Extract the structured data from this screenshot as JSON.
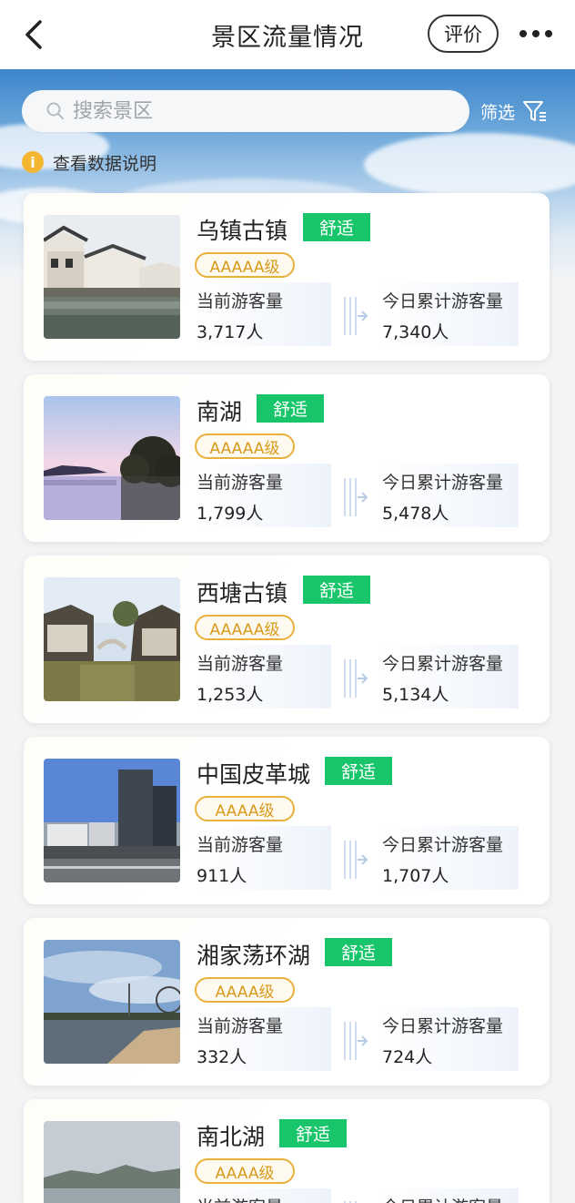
{
  "header": {
    "title": "景区流量情况",
    "rate_label": "评价"
  },
  "search": {
    "placeholder": "搜索景区",
    "filter_label": "筛选"
  },
  "data_note": "查看数据说明",
  "stat_labels": {
    "current": "当前游客量",
    "today": "今日累计游客量"
  },
  "colors": {
    "comfort_green": "#19c56a",
    "level_gold": "#e8b13c",
    "info_yellow": "#f3b633"
  },
  "spots": [
    {
      "name": "乌镇古镇",
      "status": "舒适",
      "level": "AAAAA级",
      "current": "3,717人",
      "today": "7,340人"
    },
    {
      "name": "南湖",
      "status": "舒适",
      "level": "AAAAA级",
      "current": "1,799人",
      "today": "5,478人"
    },
    {
      "name": "西塘古镇",
      "status": "舒适",
      "level": "AAAAA级",
      "current": "1,253人",
      "today": "5,134人"
    },
    {
      "name": "中国皮革城",
      "status": "舒适",
      "level": "AAAA级",
      "current": "911人",
      "today": "1,707人"
    },
    {
      "name": "湘家荡环湖",
      "status": "舒适",
      "level": "AAAA级",
      "current": "332人",
      "today": "724人"
    },
    {
      "name": "南北湖",
      "status": "舒适",
      "level": "AAAA级",
      "current": "",
      "today": ""
    }
  ]
}
